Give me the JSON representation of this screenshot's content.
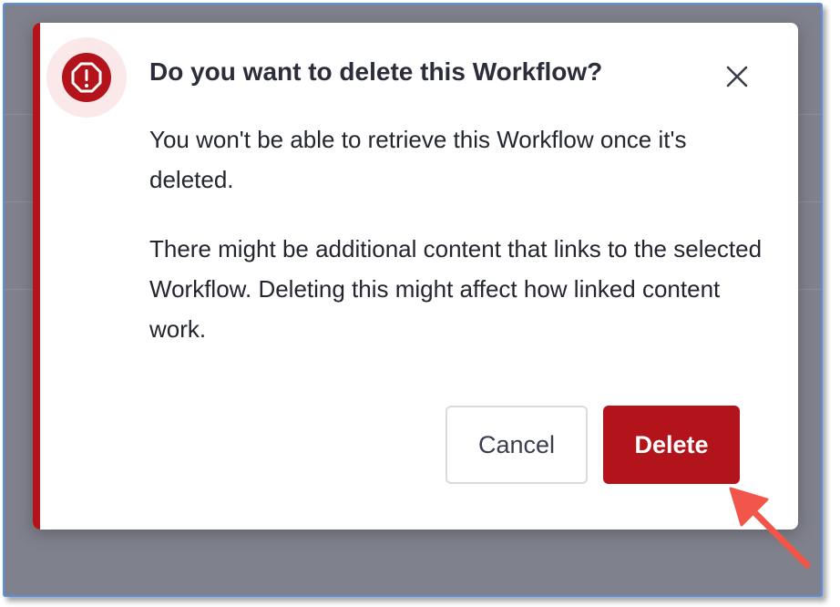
{
  "dialog": {
    "title": "Do you want to delete this Workflow?",
    "paragraph_1": "You won't be able to retrieve this Workflow once it's deleted.",
    "paragraph_2": "There might be additional content that links to the selected Workflow. Deleting this might affect how linked content work.",
    "cancel_label": "Cancel",
    "delete_label": "Delete",
    "icons": {
      "warning": "warning-octagon-icon",
      "close": "close-icon",
      "annotation": "red-arrow-annotation"
    }
  },
  "colors": {
    "accent_red": "#b3141c",
    "warning_tint": "#fbe9ea",
    "backdrop": "#7f818c",
    "frame_border": "#5a8fe6",
    "arrow": "#f2564a"
  }
}
